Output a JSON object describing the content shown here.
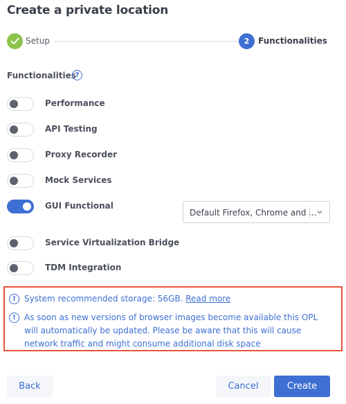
{
  "dialog": {
    "title": "Create a private location"
  },
  "stepper": {
    "steps": [
      {
        "label": "Setup",
        "status": "completed",
        "icon": "check-icon"
      },
      {
        "number": "2",
        "label": "Functionalities",
        "status": "active"
      }
    ]
  },
  "functionalities": {
    "section_label": "Functionalities",
    "help_icon": "?",
    "items": [
      {
        "label": "Performance",
        "enabled": false
      },
      {
        "label": "API Testing",
        "enabled": false
      },
      {
        "label": "Proxy Recorder",
        "enabled": false
      },
      {
        "label": "Mock Services",
        "enabled": false
      },
      {
        "label": "GUI Functional",
        "enabled": true
      },
      {
        "label": "Service Virtualization Bridge",
        "enabled": false
      },
      {
        "label": "TDM Integration",
        "enabled": false
      }
    ],
    "browser_select": {
      "value": "Default Firefox, Chrome and ..."
    }
  },
  "notices": {
    "icon": "!",
    "storage_text": "System recommended storage: 56GB. ",
    "storage_link": "Read more",
    "update_text": "As soon as new versions of browser images become available this OPL will automatically be updated. Please be aware that this will cause network traffic and might consume additional disk space"
  },
  "footer": {
    "back_label": "Back",
    "cancel_label": "Cancel",
    "create_label": "Create"
  },
  "colors": {
    "primary": "#3e6fd3",
    "success": "#8bc34a",
    "highlight_border": "#e8533a"
  }
}
